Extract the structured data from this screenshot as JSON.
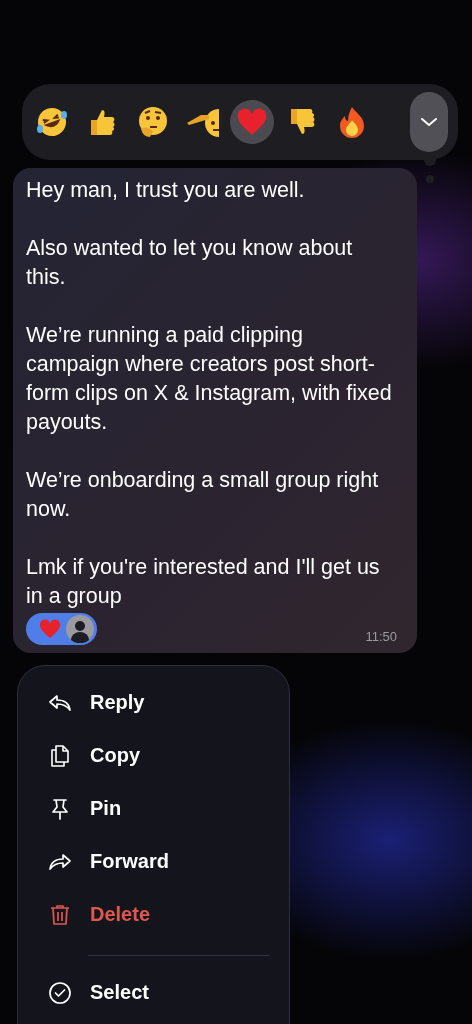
{
  "reaction_bar": {
    "reactions": [
      {
        "selected": false
      },
      {
        "selected": false
      },
      {
        "selected": false
      },
      {
        "selected": false
      },
      {
        "selected": true
      },
      {
        "selected": false
      },
      {
        "selected": false
      }
    ],
    "expand": {
      "expanded": false
    }
  },
  "message": {
    "paragraphs": [
      "Hey man, I trust you are well.",
      "Also wanted to let you know about this.",
      "We’re running a paid clipping campaign where creators post short-form clips on X & Instagram, with fixed payouts.",
      "We’re onboarding a small group right now.",
      "Lmk if you're interested and I'll get us in a group"
    ],
    "reaction_chip": {
      "selected": true
    },
    "time": "11:50"
  },
  "menu": {
    "groups": [
      [
        {
          "label": "Reply",
          "kind": "normal"
        },
        {
          "label": "Copy",
          "kind": "normal"
        },
        {
          "label": "Pin",
          "kind": "normal"
        },
        {
          "label": "Forward",
          "kind": "normal"
        },
        {
          "label": "Delete",
          "kind": "destructive"
        }
      ],
      [
        {
          "label": "Select",
          "kind": "normal"
        }
      ]
    ]
  }
}
